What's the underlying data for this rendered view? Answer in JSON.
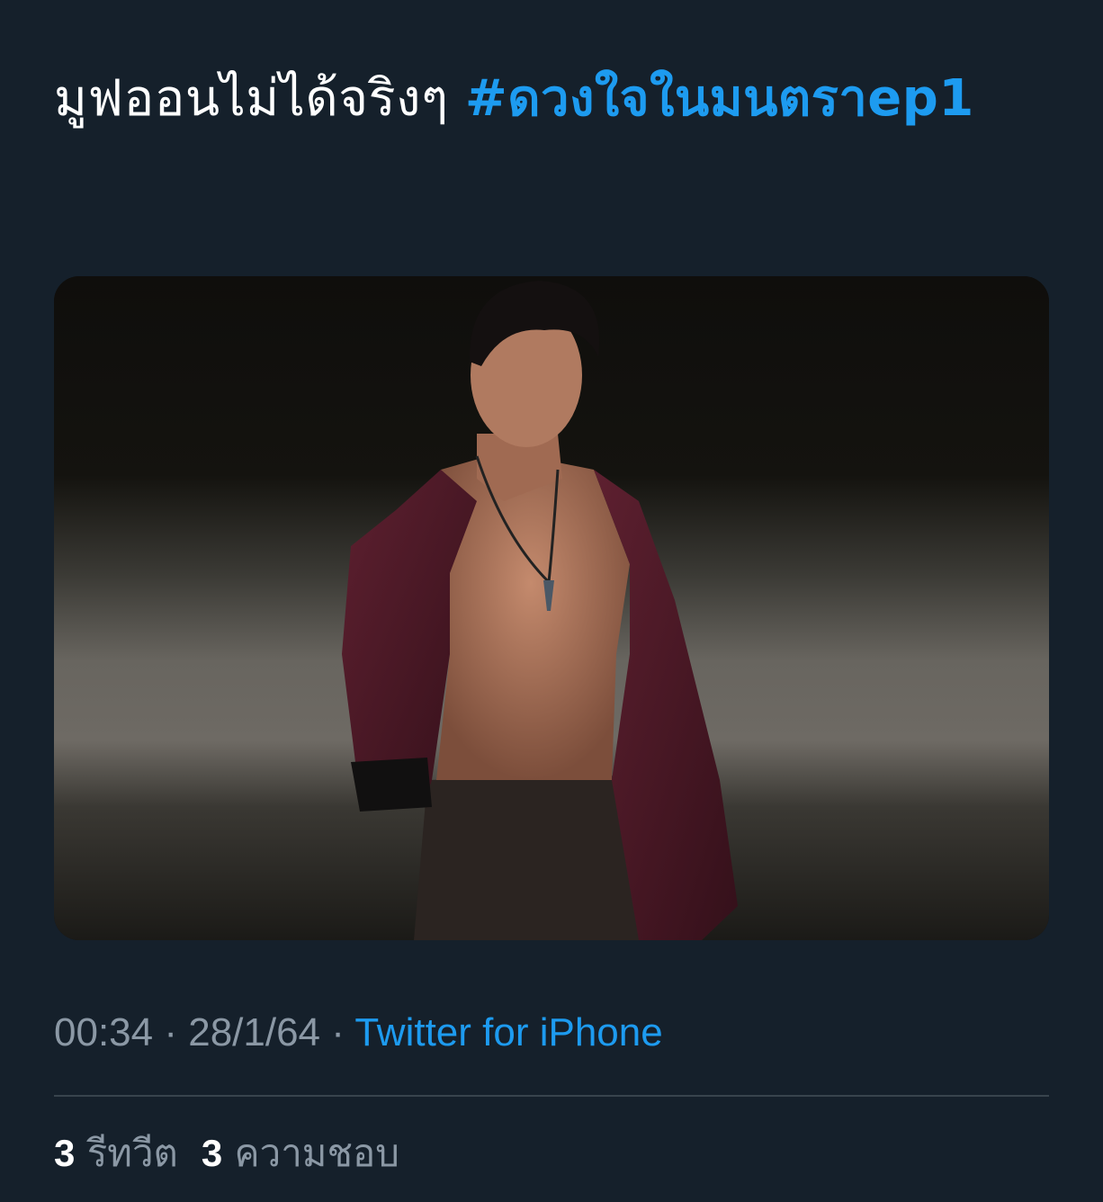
{
  "tweet": {
    "text": "มูฟออนไม่ได้จริงๆ ",
    "hashtag": "#ดวงใจในมนตราep1"
  },
  "media": {
    "alt": "photo",
    "colors": {
      "background": "#0e0d0c",
      "ground": "#6e6a64",
      "shirt": "#4e1a26",
      "skin": "#a8725a"
    }
  },
  "meta": {
    "time": "00:34",
    "separator1": " · ",
    "date": "28/1/64",
    "separator2": " · ",
    "source": "Twitter for iPhone"
  },
  "stats": {
    "retweets_count": "3",
    "retweets_label": "รีทวีต",
    "likes_count": "3",
    "likes_label": "ความชอบ"
  },
  "theme": {
    "background": "#15202b",
    "text": "#ffffff",
    "secondary": "#8b98a5",
    "accent": "#1d9bf0",
    "divider": "#38444d"
  }
}
